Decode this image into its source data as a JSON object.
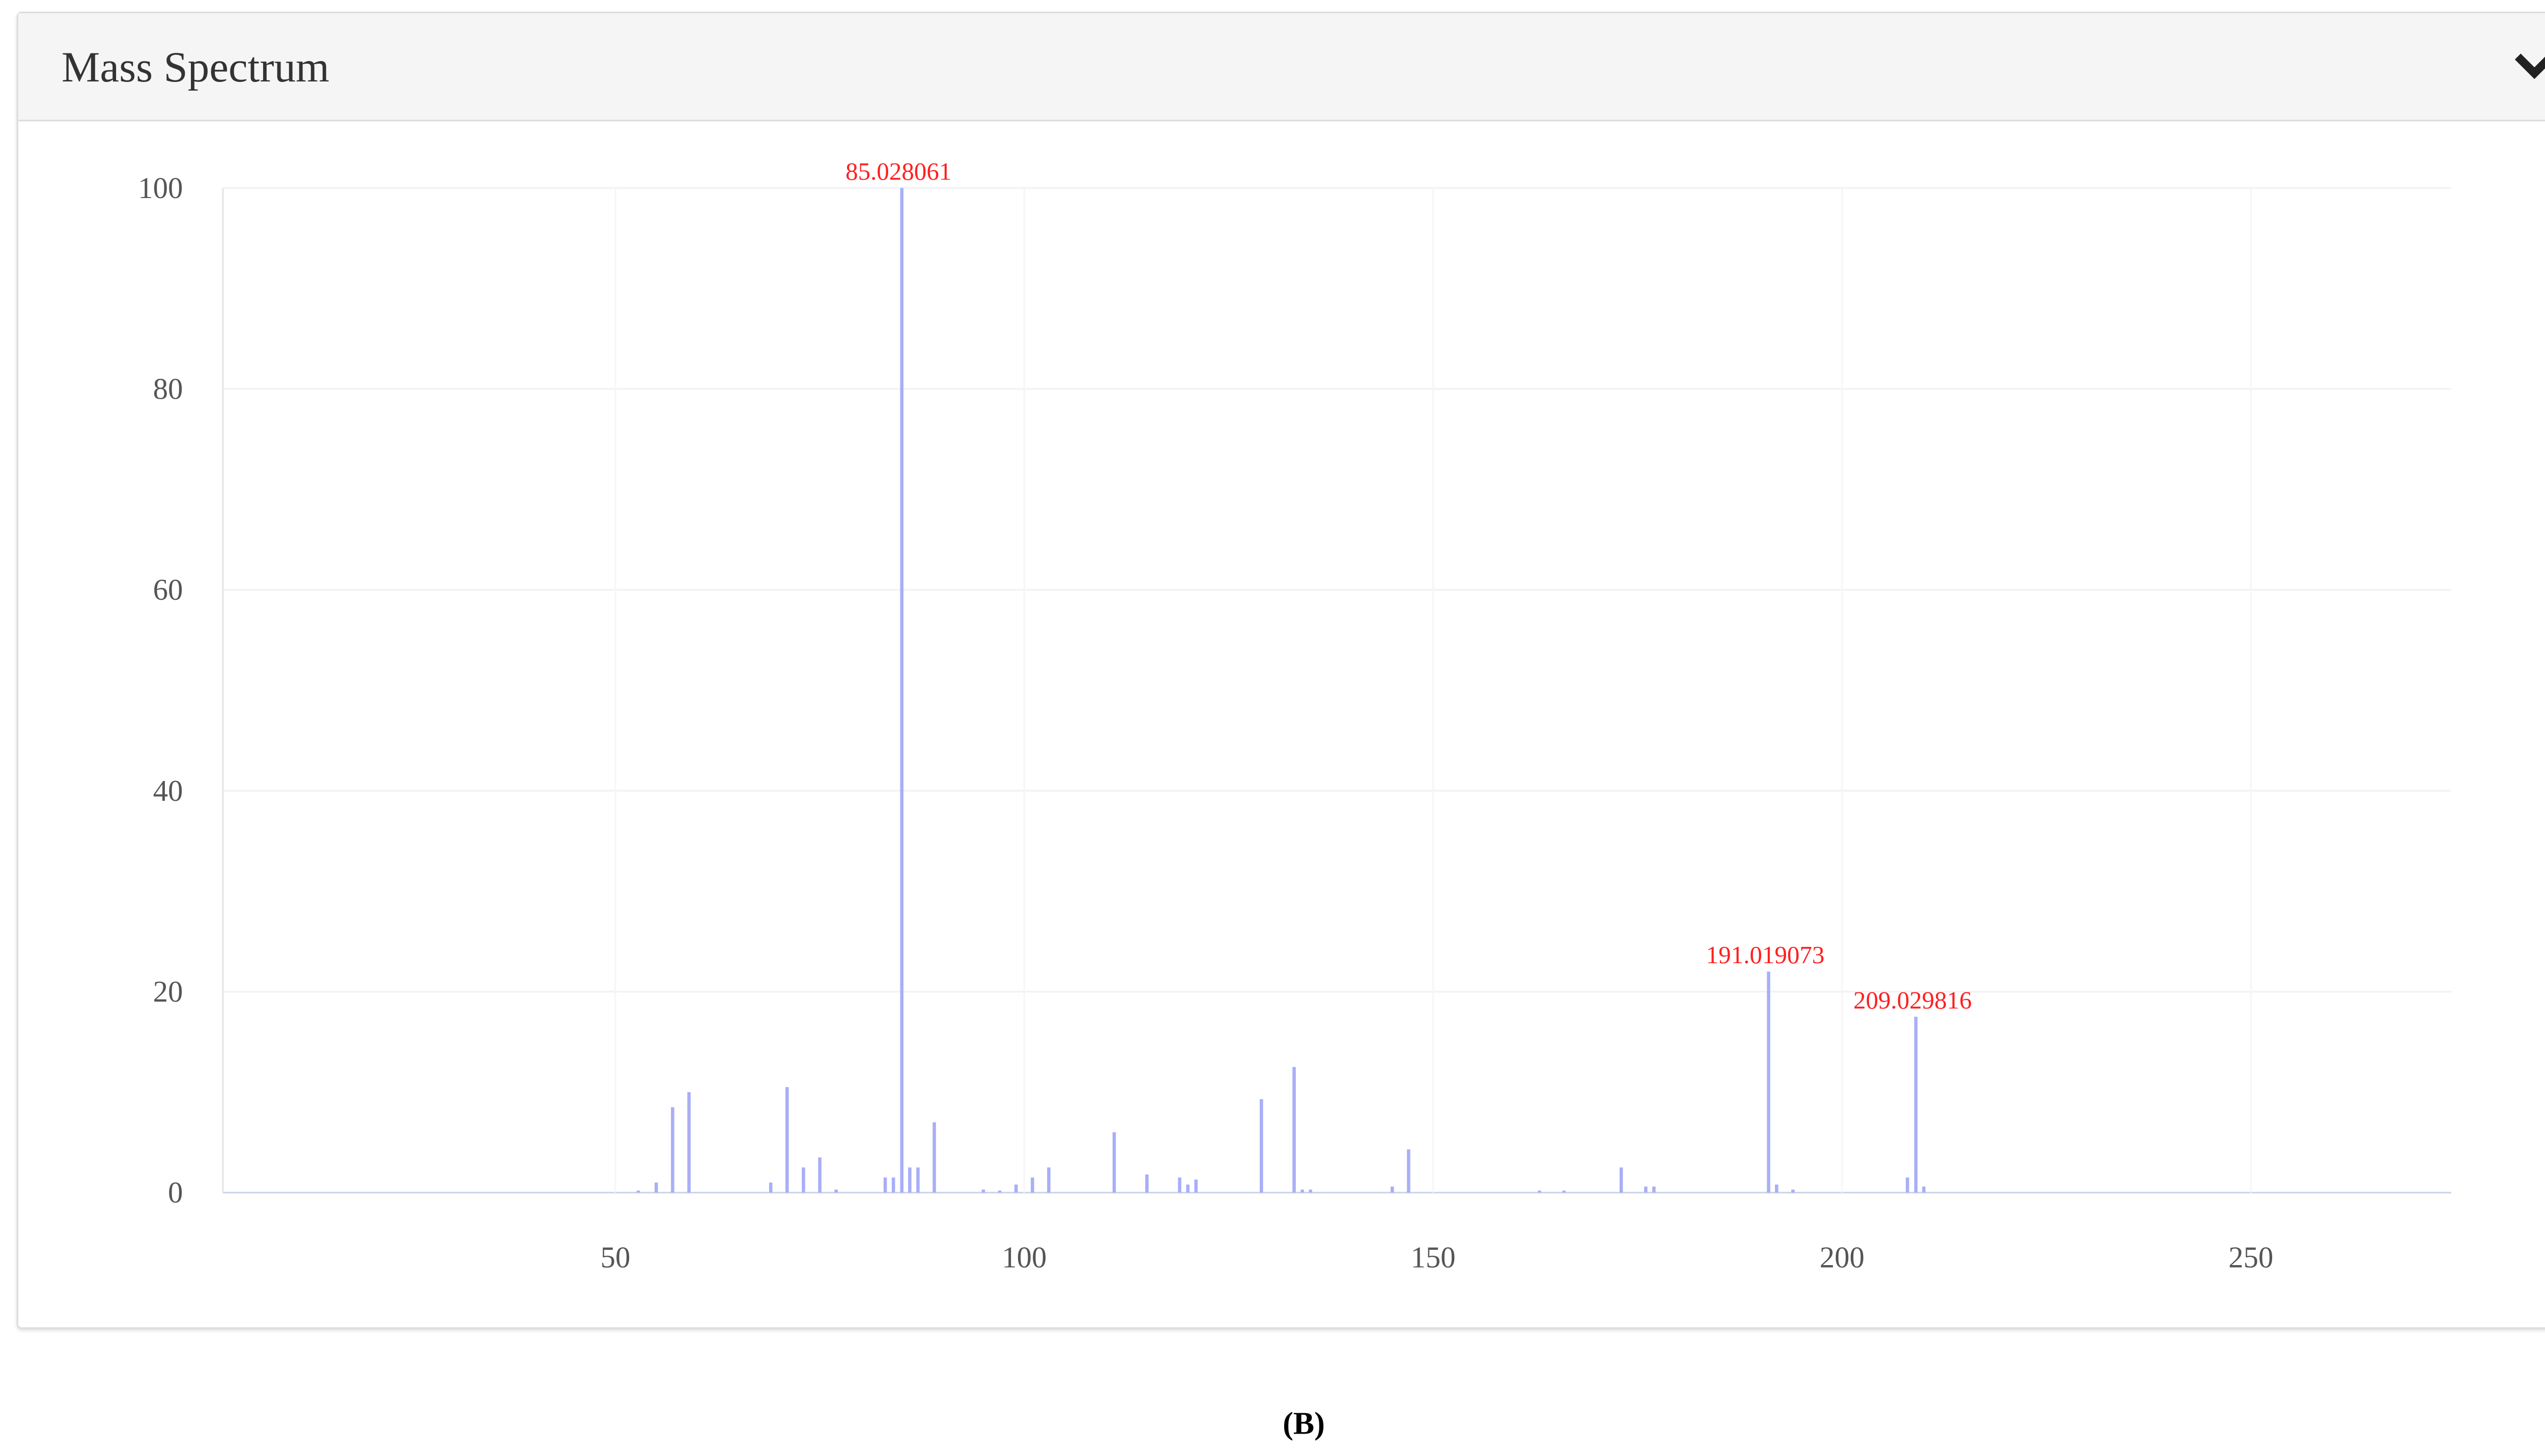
{
  "panel": {
    "title": "Mass Spectrum",
    "toggle_icon": "chevron-down-icon"
  },
  "caption": "(B)",
  "chart_data": {
    "type": "bar",
    "title": "Mass Spectrum",
    "xlabel": "",
    "ylabel": "",
    "xlim": [
      2,
      274.5
    ],
    "ylim": [
      0,
      100
    ],
    "xticks": [
      50,
      100,
      150,
      200,
      250
    ],
    "yticks": [
      0,
      20,
      40,
      60,
      80,
      100
    ],
    "grid": true,
    "bar_color": "#a9aef7",
    "label_color": "#ff2020",
    "peaks": [
      {
        "mz": 52.8,
        "intensity": 0.2
      },
      {
        "mz": 55,
        "intensity": 1
      },
      {
        "mz": 57,
        "intensity": 8.5
      },
      {
        "mz": 59,
        "intensity": 10
      },
      {
        "mz": 69,
        "intensity": 1
      },
      {
        "mz": 71,
        "intensity": 10.5
      },
      {
        "mz": 73,
        "intensity": 2.5
      },
      {
        "mz": 75,
        "intensity": 3.5
      },
      {
        "mz": 77,
        "intensity": 0.3
      },
      {
        "mz": 83,
        "intensity": 1.5
      },
      {
        "mz": 84,
        "intensity": 1.5
      },
      {
        "mz": 85.028061,
        "intensity": 100,
        "label": "85.028061"
      },
      {
        "mz": 86,
        "intensity": 2.5
      },
      {
        "mz": 87,
        "intensity": 2.5
      },
      {
        "mz": 89,
        "intensity": 7
      },
      {
        "mz": 95,
        "intensity": 0.3
      },
      {
        "mz": 97,
        "intensity": 0.2
      },
      {
        "mz": 99,
        "intensity": 0.8
      },
      {
        "mz": 101,
        "intensity": 1.5
      },
      {
        "mz": 103,
        "intensity": 2.5
      },
      {
        "mz": 111,
        "intensity": 6
      },
      {
        "mz": 115,
        "intensity": 1.8
      },
      {
        "mz": 119,
        "intensity": 1.5
      },
      {
        "mz": 120,
        "intensity": 0.8
      },
      {
        "mz": 121,
        "intensity": 1.3
      },
      {
        "mz": 129,
        "intensity": 9.3
      },
      {
        "mz": 133,
        "intensity": 12.5
      },
      {
        "mz": 134,
        "intensity": 0.3
      },
      {
        "mz": 135,
        "intensity": 0.3
      },
      {
        "mz": 145,
        "intensity": 0.6
      },
      {
        "mz": 147,
        "intensity": 4.3
      },
      {
        "mz": 163,
        "intensity": 0.2
      },
      {
        "mz": 166,
        "intensity": 0.2
      },
      {
        "mz": 173,
        "intensity": 2.5
      },
      {
        "mz": 176,
        "intensity": 0.6
      },
      {
        "mz": 177,
        "intensity": 0.6
      },
      {
        "mz": 191.019073,
        "intensity": 22,
        "label": "191.019073"
      },
      {
        "mz": 192,
        "intensity": 0.8
      },
      {
        "mz": 194,
        "intensity": 0.3
      },
      {
        "mz": 208,
        "intensity": 1.5
      },
      {
        "mz": 209.029816,
        "intensity": 17.5,
        "label": "209.029816"
      },
      {
        "mz": 210,
        "intensity": 0.6
      }
    ]
  }
}
